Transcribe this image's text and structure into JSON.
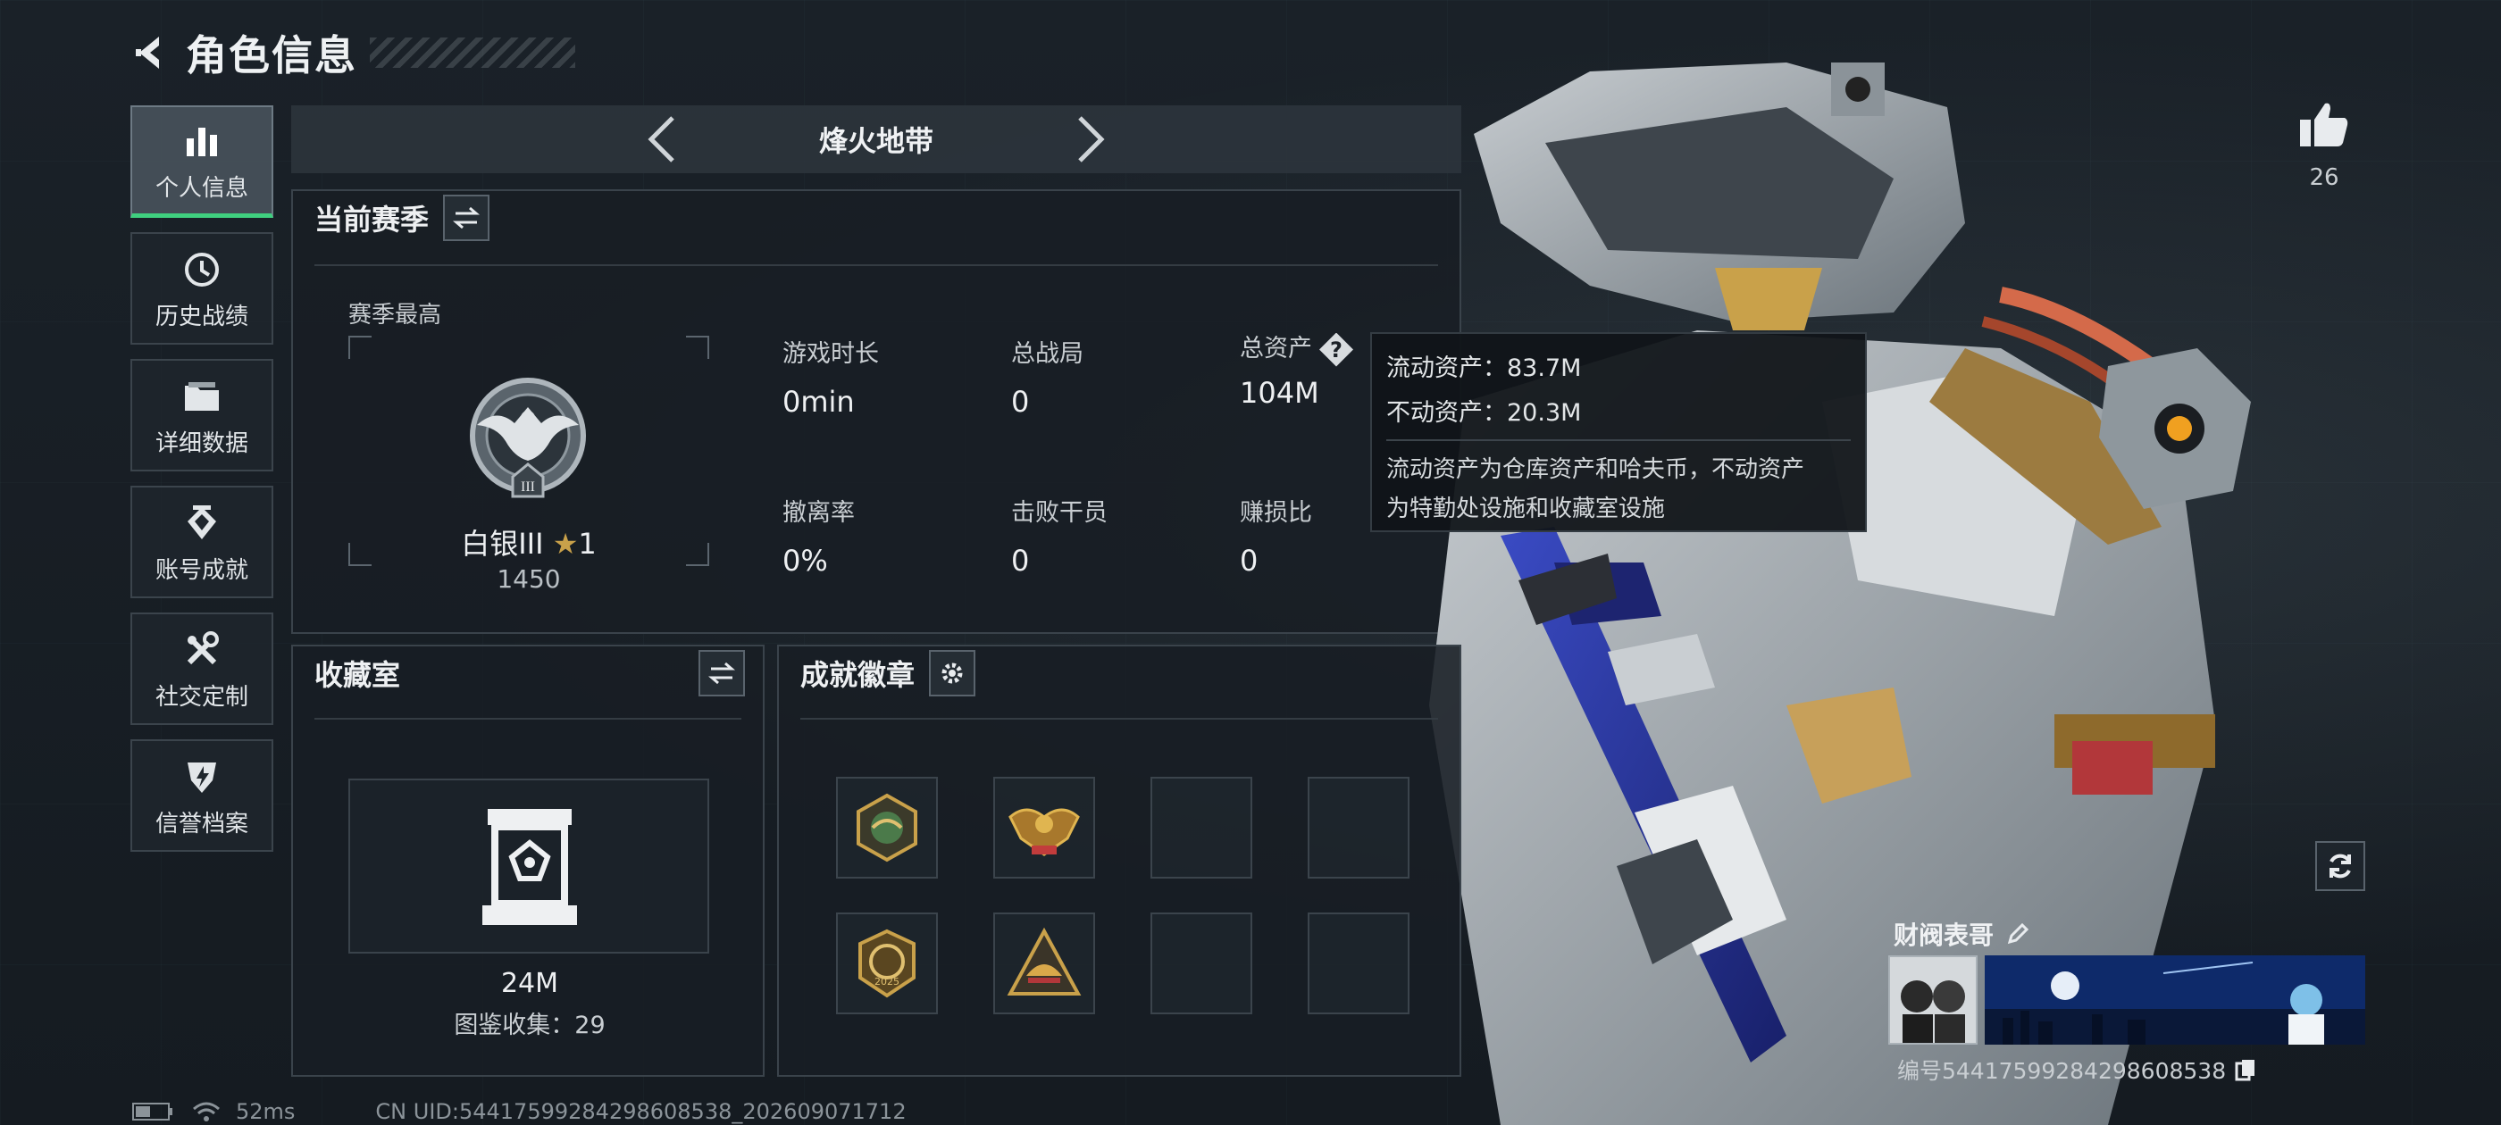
{
  "header": {
    "title": "角色信息"
  },
  "nav": {
    "items": [
      {
        "label": "个人信息",
        "icon": "bar-chart-icon",
        "active": true
      },
      {
        "label": "历史战绩",
        "icon": "history-icon"
      },
      {
        "label": "详细数据",
        "icon": "folder-icon"
      },
      {
        "label": "账号成就",
        "icon": "achievement-icon"
      },
      {
        "label": "社交定制",
        "icon": "tools-icon"
      },
      {
        "label": "信誉档案",
        "icon": "shield-icon"
      }
    ]
  },
  "mode": {
    "title": "烽火地带"
  },
  "season": {
    "title": "当前赛季",
    "best_label": "赛季最高",
    "rank_name": "白银III",
    "rank_stars": "1",
    "rank_score": "1450",
    "stats": [
      {
        "label": "游戏时长",
        "value": "0min"
      },
      {
        "label": "总战局",
        "value": "0"
      },
      {
        "label": "总资产",
        "value": "104M"
      },
      {
        "label": "撤离率",
        "value": "0%"
      },
      {
        "label": "击败干员",
        "value": "0"
      },
      {
        "label": "赚损比",
        "value": "0"
      }
    ]
  },
  "tooltip": {
    "liquid": "流动资产：83.7M",
    "fixed": "不动资产：20.3M",
    "desc_line1": "流动资产为仓库资产和哈夫币，不动资产",
    "desc_line2": "为特勤处设施和收藏室设施"
  },
  "collection": {
    "title": "收藏室",
    "value": "24M",
    "count": "图鉴收集：29"
  },
  "badges": {
    "title": "成就徽章"
  },
  "profile": {
    "likes": "26",
    "name": "财阀表哥",
    "id": "编号5441759928429860853​8"
  },
  "status": {
    "ping": "52ms",
    "uid": "CN UID:5441759928429860853​8_202609071712"
  },
  "colors": {
    "accent_green": "#3fd07f",
    "gold": "#c9a14a",
    "panel_bg": "#181e24"
  }
}
